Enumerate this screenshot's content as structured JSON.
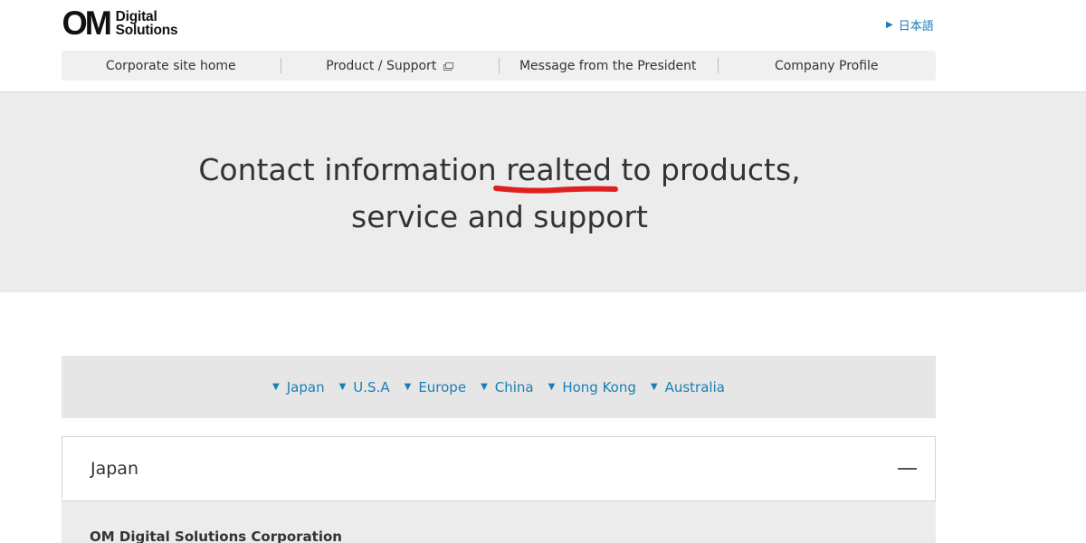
{
  "header": {
    "logo_mark": "OM",
    "logo_line1": "Digital",
    "logo_line2": "Solutions",
    "language_link": "日本語"
  },
  "nav": {
    "items": [
      {
        "label": "Corporate site home"
      },
      {
        "label": "Product / Support"
      },
      {
        "label": "Message from the President"
      },
      {
        "label": "Company Profile"
      }
    ]
  },
  "hero": {
    "title_line1": "Contact information realted to products,",
    "title_line2": "service and support",
    "annotation_color": "#e02020"
  },
  "regions": {
    "links": [
      "Japan",
      "U.S.A",
      "Europe",
      "China",
      "Hong Kong",
      "Australia"
    ]
  },
  "section": {
    "title": "Japan",
    "company": "OM Digital Solutions Corporation"
  },
  "colors": {
    "link": "#1a7fb5",
    "hero_bg": "#ececec",
    "nav_bg": "#f0f0f0"
  }
}
